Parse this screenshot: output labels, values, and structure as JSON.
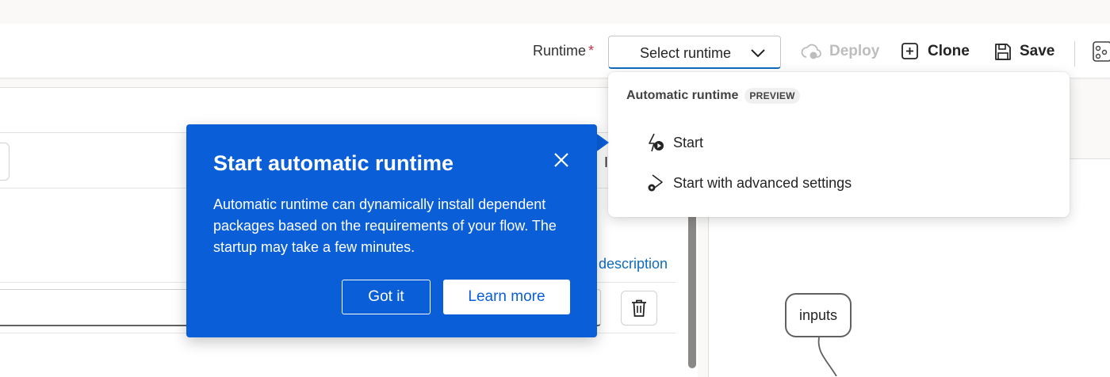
{
  "toolbar": {
    "runtime_label": "Runtime",
    "required_mark": "*",
    "runtime_select_value": "Select runtime",
    "deploy_label": "Deploy",
    "clone_label": "Clone",
    "save_label": "Save"
  },
  "runtime_menu": {
    "group_label": "Automatic runtime",
    "badge": "PREVIEW",
    "items": [
      {
        "label": "Start",
        "icon": "runtime-start-icon"
      },
      {
        "label": "Start with advanced settings",
        "icon": "runtime-settings-icon"
      }
    ]
  },
  "teaching_bubble": {
    "title": "Start automatic runtime",
    "body": "Automatic runtime can dynamically install dependent packages based on the requirements of your flow. The startup may take a few minutes.",
    "primary_label": "Got it",
    "secondary_label": "Learn more"
  },
  "editor": {
    "description_link": "description",
    "partial_char": "I"
  },
  "graph": {
    "nodes": [
      {
        "label": "inputs"
      }
    ]
  },
  "colors": {
    "accent": "#0f6cbd",
    "bubble": "#0a5ed7",
    "required": "#c4314b"
  }
}
